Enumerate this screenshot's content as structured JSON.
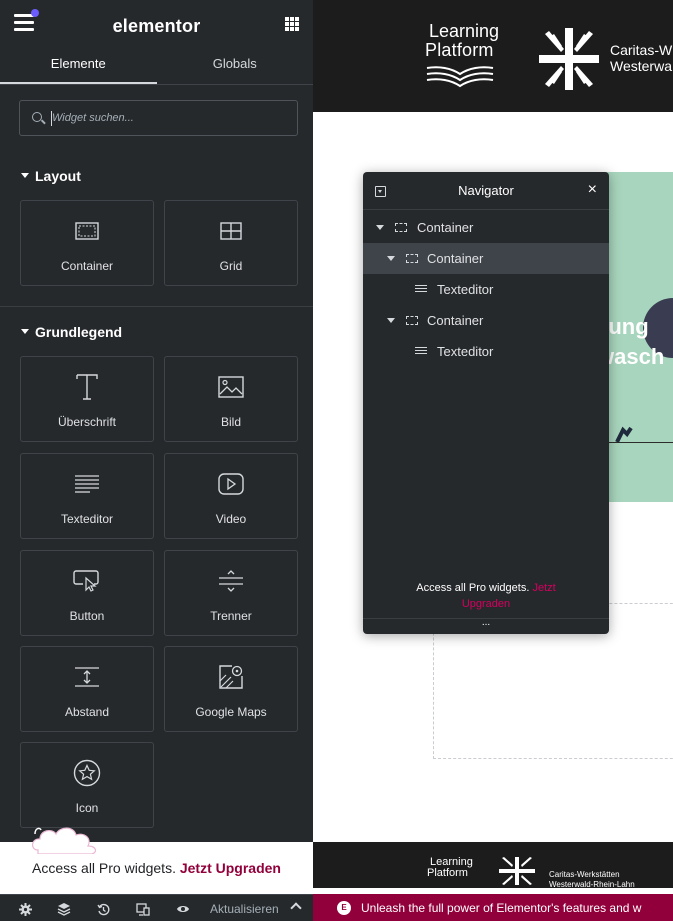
{
  "editor": {
    "brand": "elementor",
    "tabs": [
      {
        "label": "Elemente",
        "active": true
      },
      {
        "label": "Globals",
        "active": false
      }
    ],
    "search": {
      "placeholder": "Widget suchen..."
    },
    "sections": {
      "layout": "Layout",
      "basic": "Grundlegend"
    },
    "widgets": {
      "container": "Container",
      "grid": "Grid",
      "heading": "Überschrift",
      "image": "Bild",
      "text_editor": "Texteditor",
      "video": "Video",
      "button": "Button",
      "divider": "Trenner",
      "spacer": "Abstand",
      "google_maps": "Google Maps",
      "icon": "Icon"
    },
    "pro_banner": {
      "text": "Access all Pro widgets. ",
      "link": "Jetzt Upgraden"
    },
    "footer": {
      "update": "Aktualisieren"
    },
    "colors": {
      "panel_bg": "#26292c",
      "accent": "#92003b",
      "pro_link": "#d5005f"
    }
  },
  "preview": {
    "header": {
      "logo_line1": "Learning",
      "logo_line2": "Platform",
      "partner_line1": "Caritas-W",
      "partner_line2": "Westerwa"
    },
    "hero": {
      "line1": "tung",
      "line2": "wasch"
    },
    "mini_footer": {
      "logo_line1": "Learning",
      "logo_line2": "Platform",
      "partner_line1": "Caritas-Werkstätten",
      "partner_line2": "Westerwald-Rhein-Lahn"
    },
    "promo_bar": {
      "badge": "E",
      "text": "Unleash the full power of Elementor's features and w"
    }
  },
  "navigator": {
    "title": "Navigator",
    "close": "×",
    "items": [
      {
        "label": "Container",
        "type": "container",
        "level": 0,
        "selected": false
      },
      {
        "label": "Container",
        "type": "container",
        "level": 1,
        "selected": true
      },
      {
        "label": "Texteditor",
        "type": "text",
        "level": 2,
        "selected": false
      },
      {
        "label": "Container",
        "type": "container",
        "level": 1,
        "selected": false
      },
      {
        "label": "Texteditor",
        "type": "text",
        "level": 2,
        "selected": false
      }
    ],
    "pro_text": "Access all Pro widgets. ",
    "pro_link_1": "Jetzt",
    "pro_link_2": "Upgraden",
    "more": "..."
  }
}
